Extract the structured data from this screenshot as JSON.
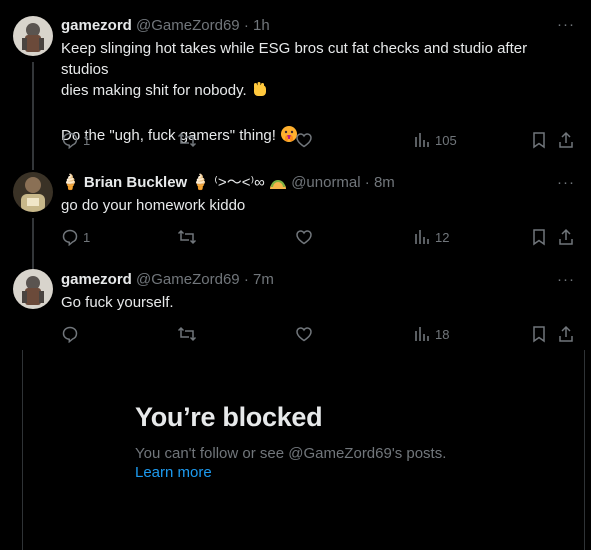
{
  "tweets": [
    {
      "name": "gamezord",
      "handle": "@GameZord69",
      "time": "· 1h",
      "more": "···",
      "text_line1": "Keep slinging hot takes while ESG bros cut fat checks and studio after studios",
      "text_line2": "dies making shit for nobody.",
      "text_line3": "Do the \"ugh, fuck gamers\" thing!",
      "reply_count": "1",
      "views": "105"
    },
    {
      "name_prefix": "🍦",
      "name": "Brian Bucklew",
      "name_suffix": "🍦 ⁽>～<⁾∞",
      "handle": "@unormal",
      "time": "· 8m",
      "more": "···",
      "text": "go do your homework kiddo",
      "reply_count": "1",
      "views": "12"
    },
    {
      "name": "gamezord",
      "handle": "@GameZord69",
      "time": "· 7m",
      "more": "···",
      "text": "Go fuck yourself.",
      "reply_count": "",
      "views": "18"
    }
  ],
  "blocked": {
    "title": "You’re blocked",
    "desc": "You can't follow or see @GameZord69's posts.",
    "link": "Learn more"
  },
  "colors": {
    "background": "#000000",
    "text": "#e7e9ea",
    "muted": "#71767b",
    "link": "#1d9bf0"
  },
  "icons": [
    "reply-icon",
    "retweet-icon",
    "like-icon",
    "views-icon",
    "bookmark-icon",
    "share-icon",
    "more-icon"
  ]
}
